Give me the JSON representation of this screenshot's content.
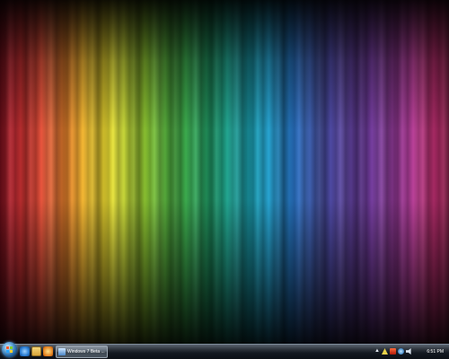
{
  "desktop": {
    "wallpaper": "rainbow-vertical-streaks"
  },
  "taskbar": {
    "start_button_icon": "windows-logo-icon",
    "quick_launch": [
      {
        "icon": "internet-explorer-icon"
      },
      {
        "icon": "folder-explorer-icon"
      },
      {
        "icon": "media-player-icon"
      }
    ],
    "open_window": {
      "label": "Windows 7 Beta ...",
      "icon": "window-icon"
    },
    "tray": {
      "icons": [
        "show-hidden-icons-chevron",
        "action-center-icon",
        "flag-icon",
        "network-icon",
        "volume-icon"
      ]
    },
    "clock": "6:51 PM"
  }
}
